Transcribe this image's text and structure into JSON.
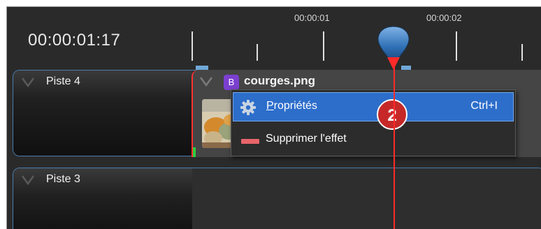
{
  "header": {
    "timecode": "00:00:01:17"
  },
  "ruler": {
    "labels": [
      "00:00:01",
      "00:00:02"
    ]
  },
  "tracks": [
    {
      "name": "Piste 4"
    },
    {
      "name": "Piste 3"
    }
  ],
  "clip": {
    "badge": "B",
    "name": "courges.png"
  },
  "context_menu": {
    "items": [
      {
        "label_mnemonic": "P",
        "label_rest": "ropriétés",
        "shortcut": "Ctrl+I",
        "icon": "gear-icon",
        "selected": true
      },
      {
        "label": "Supprimer l'effet",
        "icon": "remove-effect-icon",
        "selected": false
      }
    ]
  },
  "annotation": {
    "step": "2"
  },
  "colors": {
    "background": "#2a2a2a",
    "track_border": "#4a7bb0",
    "playhead": "#ff2a2a",
    "menu_selected": "#2d6ecb",
    "effect_badge": "#7b3fd0",
    "step_badge": "#c62828"
  }
}
